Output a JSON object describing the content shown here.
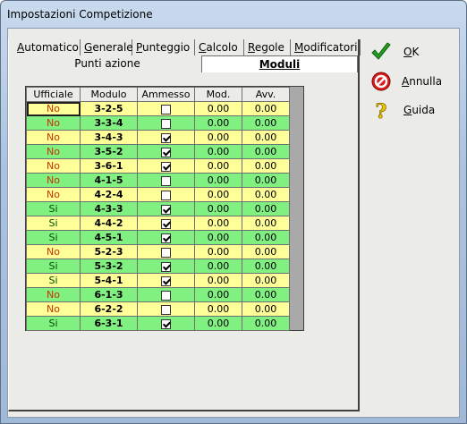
{
  "window": {
    "title": "Impostazioni Competizione"
  },
  "tabs_row1": [
    {
      "label": "Automatico",
      "ul": "A",
      "rest": "utomatico"
    },
    {
      "label": "Generale",
      "ul": "G",
      "rest": "enerale"
    },
    {
      "label": "Punteggio",
      "ul": "P",
      "rest": "unteggio"
    },
    {
      "label": "Calcolo",
      "ul": "C",
      "rest": "alcolo"
    },
    {
      "label": "Regole",
      "ul": "R",
      "rest": "egole"
    },
    {
      "label": "Modificatori",
      "ul": "M",
      "rest": "odificatori"
    }
  ],
  "tabs_row2": [
    {
      "label": "Punti azione",
      "active": false
    },
    {
      "label": "Moduli",
      "active": true
    }
  ],
  "grid": {
    "headers": [
      "Ufficiale",
      "Modulo",
      "Ammesso",
      "Mod.",
      "Avv."
    ],
    "rows": [
      {
        "ufficiale": "No",
        "modulo": "3-2-5",
        "ammesso": false,
        "mod": "0.00",
        "avv": "0.00",
        "color": "y"
      },
      {
        "ufficiale": "No",
        "modulo": "3-3-4",
        "ammesso": false,
        "mod": "0.00",
        "avv": "0.00",
        "color": "g"
      },
      {
        "ufficiale": "No",
        "modulo": "3-4-3",
        "ammesso": true,
        "mod": "0.00",
        "avv": "0.00",
        "color": "y"
      },
      {
        "ufficiale": "No",
        "modulo": "3-5-2",
        "ammesso": true,
        "mod": "0.00",
        "avv": "0.00",
        "color": "g"
      },
      {
        "ufficiale": "No",
        "modulo": "3-6-1",
        "ammesso": true,
        "mod": "0.00",
        "avv": "0.00",
        "color": "y"
      },
      {
        "ufficiale": "No",
        "modulo": "4-1-5",
        "ammesso": false,
        "mod": "0.00",
        "avv": "0.00",
        "color": "g"
      },
      {
        "ufficiale": "No",
        "modulo": "4-2-4",
        "ammesso": false,
        "mod": "0.00",
        "avv": "0.00",
        "color": "y"
      },
      {
        "ufficiale": "Si",
        "modulo": "4-3-3",
        "ammesso": true,
        "mod": "0.00",
        "avv": "0.00",
        "color": "g"
      },
      {
        "ufficiale": "Si",
        "modulo": "4-4-2",
        "ammesso": true,
        "mod": "0.00",
        "avv": "0.00",
        "color": "y"
      },
      {
        "ufficiale": "Si",
        "modulo": "4-5-1",
        "ammesso": true,
        "mod": "0.00",
        "avv": "0.00",
        "color": "g"
      },
      {
        "ufficiale": "No",
        "modulo": "5-2-3",
        "ammesso": false,
        "mod": "0.00",
        "avv": "0.00",
        "color": "y"
      },
      {
        "ufficiale": "Si",
        "modulo": "5-3-2",
        "ammesso": true,
        "mod": "0.00",
        "avv": "0.00",
        "color": "g"
      },
      {
        "ufficiale": "Si",
        "modulo": "5-4-1",
        "ammesso": true,
        "mod": "0.00",
        "avv": "0.00",
        "color": "y"
      },
      {
        "ufficiale": "No",
        "modulo": "6-1-3",
        "ammesso": false,
        "mod": "0.00",
        "avv": "0.00",
        "color": "g"
      },
      {
        "ufficiale": "No",
        "modulo": "6-2-2",
        "ammesso": false,
        "mod": "0.00",
        "avv": "0.00",
        "color": "y"
      },
      {
        "ufficiale": "Si",
        "modulo": "6-3-1",
        "ammesso": true,
        "mod": "0.00",
        "avv": "0.00",
        "color": "g"
      }
    ]
  },
  "buttons": {
    "ok": {
      "label": "OK",
      "ul": "O",
      "rest": "K",
      "icon": "checkmark-icon"
    },
    "cancel": {
      "label": "Annulla",
      "ul": "A",
      "rest": "nnulla",
      "icon": "no-entry-icon"
    },
    "help": {
      "label": "Guida",
      "ul": "G",
      "rest": "uida",
      "icon": "question-icon"
    }
  },
  "colors": {
    "row_yellow": "#ffff99",
    "row_green": "#80f080",
    "no_text": "#cc3300",
    "si_text": "#004d00"
  }
}
